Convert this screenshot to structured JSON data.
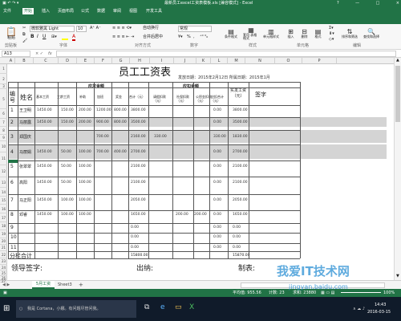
{
  "window": {
    "title": "最新员工excel工资表模板.xls  [兼容模式] - Excel",
    "controls": [
      "?",
      "—",
      "□",
      "×"
    ]
  },
  "ribbon": {
    "tabs": [
      "文件",
      "开始",
      "插入",
      "页面布局",
      "公式",
      "数据",
      "审阅",
      "视图",
      "开发工具"
    ],
    "active_tab": "开始",
    "font": {
      "name": "微软雅黑 Light",
      "size": "10"
    },
    "number_format": "常规",
    "groups": [
      "剪贴板",
      "字体",
      "对齐方式",
      "数字",
      "样式",
      "单元格",
      "编辑"
    ],
    "buttons": {
      "paste": "粘贴",
      "conditional_formatting": "条件格式",
      "table_format": "套用\n表格格式",
      "cell_styles": "单元格样式",
      "insert": "插入",
      "delete": "删除",
      "format": "格式",
      "sort_filter": "排序和筛选",
      "find_select": "查找和选择"
    },
    "wrap_text": "自动换行",
    "merge_center": "合并后居中",
    "percent": "%",
    "comma": ","
  },
  "formula_bar": {
    "name_box": "A13",
    "formula": "",
    "fx": "fx"
  },
  "columns": [
    "A",
    "B",
    "C",
    "D",
    "E",
    "F",
    "G",
    "H",
    "I",
    "J",
    "K",
    "L",
    "M",
    "N",
    "O",
    "P"
  ],
  "rows": [
    "1",
    "2",
    "3",
    "5",
    "6",
    "7",
    "8",
    "9",
    "10",
    "11",
    "12",
    "13",
    "14",
    "15",
    "16",
    "17",
    "18",
    "19",
    "20",
    "21",
    "22",
    "23",
    "24",
    "25",
    "26",
    "27"
  ],
  "payroll": {
    "title": "员工工资表",
    "pay_date_label": "发放日期：2015年2月12日  所属日期：2015年1月",
    "headers": {
      "no": "编号",
      "name": "姓名",
      "payable": "应发金额",
      "deduct": "应扣金额",
      "actual": "实发工资（元）",
      "sign": "签字",
      "basic": "基本工资",
      "seniority": "工龄工资",
      "subsidy": "补助",
      "overtime": "加班",
      "bonus": "奖金",
      "total": "合计（元）",
      "penalty": "请假扣款（元）",
      "tax": "社保扣款（元）",
      "fund": "公积金扣款（元）",
      "deduct_total": "应扣合计（元）"
    },
    "employees": [
      {
        "no": "1",
        "name": "王卫明",
        "basic": "1450.00",
        "seniority": "150.00",
        "subsidy": "200.00",
        "overtime": "1200.00",
        "bonus": "800.00",
        "total": "3800.00",
        "penalty": "",
        "tax": "",
        "fund": "",
        "deduct_total": "0.00",
        "actual": "3800.00",
        "row_index": 0,
        "shaded": false
      },
      {
        "no": "2",
        "name": "马丽露",
        "basic": "1450.00",
        "seniority": "150.00",
        "subsidy": "200.00",
        "overtime": "900.00",
        "bonus": "800.00",
        "total": "3500.00",
        "penalty": "",
        "tax": "",
        "fund": "",
        "deduct_total": "0.00",
        "actual": "3500.00",
        "row_index": 1,
        "shaded": true
      },
      {
        "no": "3",
        "name": "郑国庆",
        "basic": "",
        "seniority": "",
        "subsidy": "",
        "overtime": "700.00",
        "bonus": "",
        "total": "2160.00",
        "penalty": "330.00",
        "tax": "",
        "fund": "",
        "deduct_total": "330.00",
        "actual": "1830.00",
        "row_index": 2,
        "shaded": true
      },
      {
        "no": "4",
        "name": "马丽娟",
        "basic": "1450.00",
        "seniority": "50.00",
        "subsidy": "100.00",
        "overtime": "700.00",
        "bonus": "400.00",
        "total": "2700.00",
        "penalty": "",
        "tax": "",
        "fund": "",
        "deduct_total": "0.00",
        "actual": "2700.00",
        "row_index": 3,
        "shaded": true
      },
      {
        "no": "5",
        "name": "张翠翠",
        "basic": "1450.00",
        "seniority": "50.00",
        "subsidy": "100.00",
        "overtime": "",
        "bonus": "",
        "total": "2100.00",
        "penalty": "",
        "tax": "",
        "fund": "",
        "deduct_total": "0.00",
        "actual": "2100.00",
        "row_index": 4,
        "shaded": false
      },
      {
        "no": "6",
        "name": "高阳",
        "basic": "1450.00",
        "seniority": "50.00",
        "subsidy": "100.00",
        "overtime": "",
        "bonus": "",
        "total": "2100.00",
        "penalty": "",
        "tax": "",
        "fund": "",
        "deduct_total": "0.00",
        "actual": "2100.00",
        "row_index": 5,
        "shaded": false
      },
      {
        "no": "7",
        "name": "马正阳",
        "basic": "1450.00",
        "seniority": "100.00",
        "subsidy": "100.00",
        "overtime": "",
        "bonus": "",
        "total": "2050.00",
        "penalty": "",
        "tax": "",
        "fund": "",
        "deduct_total": "0.00",
        "actual": "2050.00",
        "row_index": 6,
        "shaded": false
      },
      {
        "no": "8",
        "name": "邓睿",
        "basic": "1450.00",
        "seniority": "100.00",
        "subsidy": "100.00",
        "overtime": "",
        "bonus": "",
        "total": "1650.00",
        "penalty": "",
        "tax": "200.00",
        "fund": "200.00",
        "deduct_total": "0.00",
        "actual": "1650.00",
        "row_index": 7,
        "shaded": false
      },
      {
        "no": "9",
        "name": "",
        "basic": "",
        "seniority": "",
        "subsidy": "",
        "overtime": "",
        "bonus": "",
        "total": "0.00",
        "penalty": "",
        "tax": "",
        "fund": "",
        "deduct_total": "0.00",
        "actual": "0.00",
        "row_index": 8,
        "shaded": false
      },
      {
        "no": "10",
        "name": "",
        "basic": "",
        "seniority": "",
        "subsidy": "",
        "overtime": "",
        "bonus": "",
        "total": "0.00",
        "penalty": "",
        "tax": "",
        "fund": "",
        "deduct_total": "0.00",
        "actual": "0.00",
        "row_index": 9,
        "shaded": false
      },
      {
        "no": "11",
        "name": "",
        "basic": "",
        "seniority": "",
        "subsidy": "",
        "overtime": "",
        "bonus": "",
        "total": "0.00",
        "penalty": "",
        "tax": "",
        "fund": "",
        "deduct_total": "0.00",
        "actual": "0.00",
        "row_index": 10,
        "shaded": false
      }
    ],
    "total_label": "分栏合计",
    "total_value": "15800.00",
    "total_actual": "15870.00",
    "signatures": {
      "leader": "领导签字:",
      "cashier": "出纳:",
      "preparer": "制表:"
    }
  },
  "sheets": {
    "tabs": [
      "5月工资",
      "Sheet3"
    ],
    "active": "5月工资",
    "add": "+"
  },
  "status_bar": {
    "sum_label": "平均值: 955.56",
    "count_label": "计数: 23",
    "total_label": "求和: 23880",
    "zoom": "100%"
  },
  "taskbar": {
    "search": "我是 Cortana，小娜。有问题尽管问我。",
    "time": "14:43",
    "date": "2016-03-15"
  },
  "watermark": {
    "brand": "我爱IT技术网",
    "url": "jingyan.baidu.com"
  }
}
